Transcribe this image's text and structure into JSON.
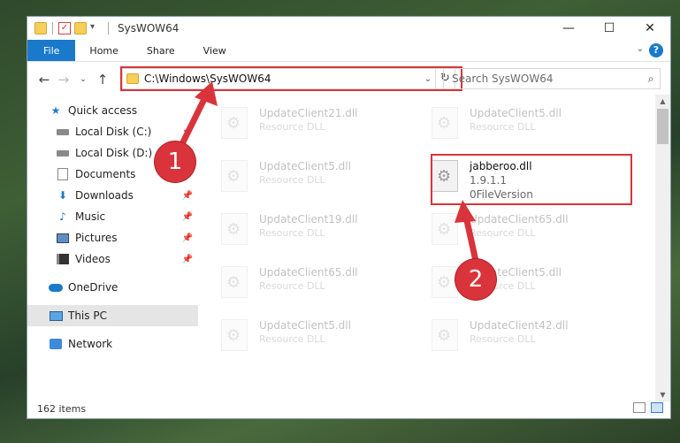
{
  "window": {
    "title": "SysWOW64",
    "controls": {
      "minimize": "—",
      "maximize": "☐",
      "close": "✕"
    }
  },
  "ribbon": {
    "tabs": [
      "File",
      "Home",
      "Share",
      "View"
    ],
    "help": "?"
  },
  "nav": {
    "address_path": "C:\\Windows\\SysWOW64",
    "search_placeholder": "Search SysWOW64"
  },
  "sidebar": {
    "items": [
      {
        "label": "Quick access",
        "icon": "star-icon"
      },
      {
        "label": "Local Disk (C:)",
        "icon": "disk-icon",
        "pinned": true
      },
      {
        "label": "Local Disk (D:)",
        "icon": "disk-icon",
        "pinned": true
      },
      {
        "label": "Documents",
        "icon": "documents-icon",
        "pinned": true
      },
      {
        "label": "Downloads",
        "icon": "download-icon",
        "pinned": true
      },
      {
        "label": "Music",
        "icon": "music-icon",
        "pinned": true
      },
      {
        "label": "Pictures",
        "icon": "pictures-icon",
        "pinned": true
      },
      {
        "label": "Videos",
        "icon": "videos-icon",
        "pinned": true
      },
      {
        "label": "OneDrive",
        "icon": "onedrive-icon"
      },
      {
        "label": "This PC",
        "icon": "computer-icon",
        "selected": true
      },
      {
        "label": "Network",
        "icon": "network-icon"
      }
    ]
  },
  "files": [
    {
      "name": "UpdateClient21.dll",
      "type": "Resource DLL"
    },
    {
      "name": "UpdateClient5.dll",
      "type": "Resource DLL"
    },
    {
      "name": "UpdateClient5.dll",
      "type": "Resource DLL"
    },
    {
      "name": "jabberoo.dll",
      "type": "1.9.1.1",
      "extra": "0FileVersion"
    },
    {
      "name": "UpdateClient19.dll",
      "type": "Resource DLL"
    },
    {
      "name": "UpdateClient65.dll",
      "type": "Resource DLL"
    },
    {
      "name": "UpdateClient65.dll",
      "type": "Resource DLL"
    },
    {
      "name": "UpdateClient5.dll",
      "type": "Resource DLL"
    },
    {
      "name": "UpdateClient5.dll",
      "type": "Resource DLL"
    },
    {
      "name": "UpdateClient42.dll",
      "type": "Resource DLL"
    }
  ],
  "status": {
    "item_count": "162 items"
  },
  "annotations": {
    "step1": "1",
    "step2": "2",
    "color": "#d9343b"
  }
}
